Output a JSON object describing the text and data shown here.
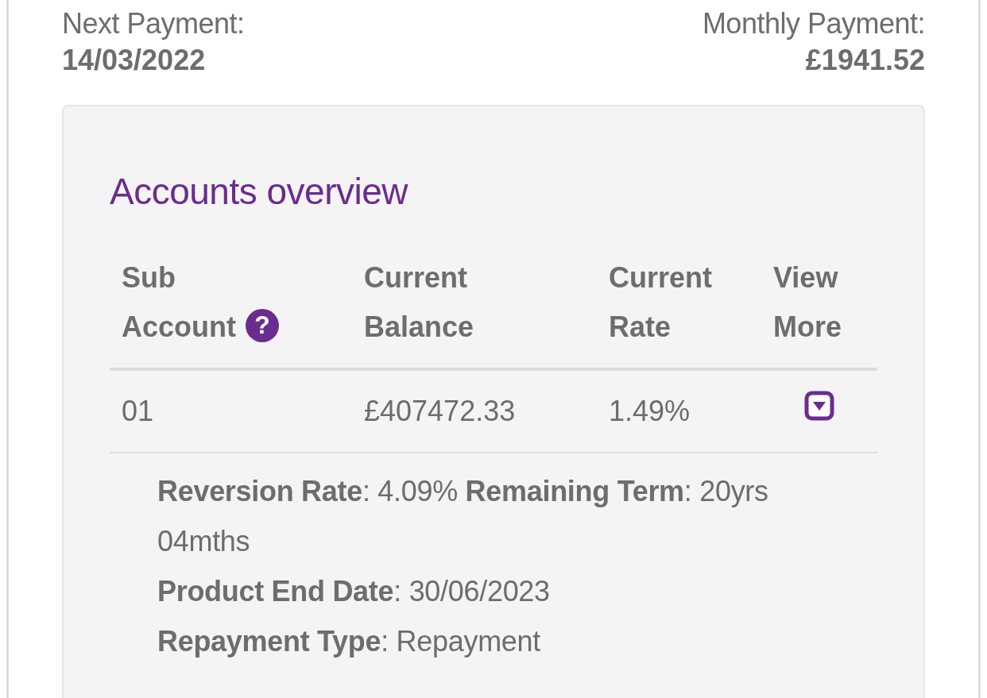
{
  "summary": [
    {
      "label": "Next Payment:",
      "value": "14/03/2022"
    },
    {
      "label": "Monthly Payment:",
      "value": "£1941.52"
    }
  ],
  "accounts_overview": {
    "title": "Accounts overview",
    "columns": [
      {
        "label": "Sub Account",
        "help": "?"
      },
      {
        "label": "Current Balance"
      },
      {
        "label": "Current Rate"
      },
      {
        "label": "View More"
      }
    ],
    "rows": [
      {
        "sub_account": "01",
        "current_balance": "£407472.33",
        "current_rate": "1.49%",
        "expanded": true,
        "details": [
          [
            "**Reversion Rate**: 4.09%",
            "**Remaining Term**: 20yrs 04mths"
          ],
          [
            "**Product End Date**: 30/06/2023"
          ],
          [
            "**Repayment Type**: Repayment"
          ]
        ]
      }
    ]
  }
}
